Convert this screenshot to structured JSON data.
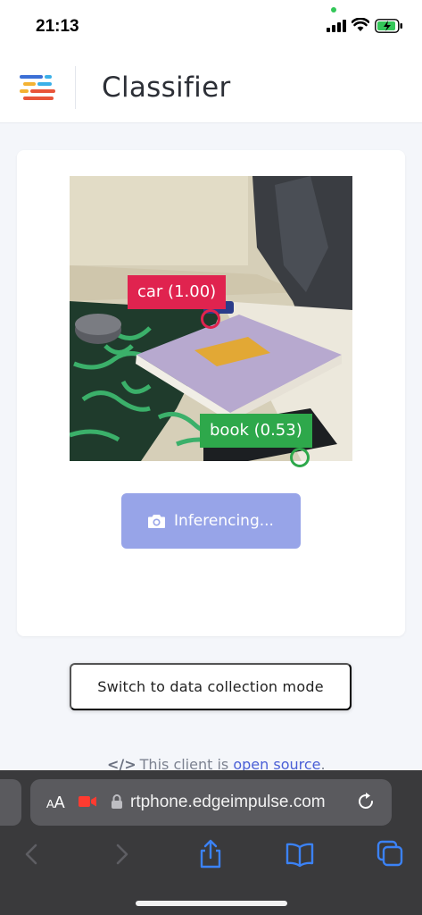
{
  "status_bar": {
    "time": "21:13"
  },
  "header": {
    "title": "Classifier"
  },
  "detections": [
    {
      "label": "car (1.00)",
      "color": "#e0234f"
    },
    {
      "label": "book (0.53)",
      "color": "#2ea84b"
    }
  ],
  "inference_button": {
    "label": "Inferencing...",
    "icon": "camera-icon"
  },
  "switch_button": {
    "label": "Switch to data collection mode"
  },
  "footer": {
    "prefix": "This client is ",
    "link": "open source",
    "suffix": "."
  },
  "browser": {
    "aa_small": "A",
    "aa_large": "A",
    "url": "rtphone.edgeimpulse.com"
  },
  "colors": {
    "accent": "#97a4e8",
    "link": "#4a5fd6"
  }
}
